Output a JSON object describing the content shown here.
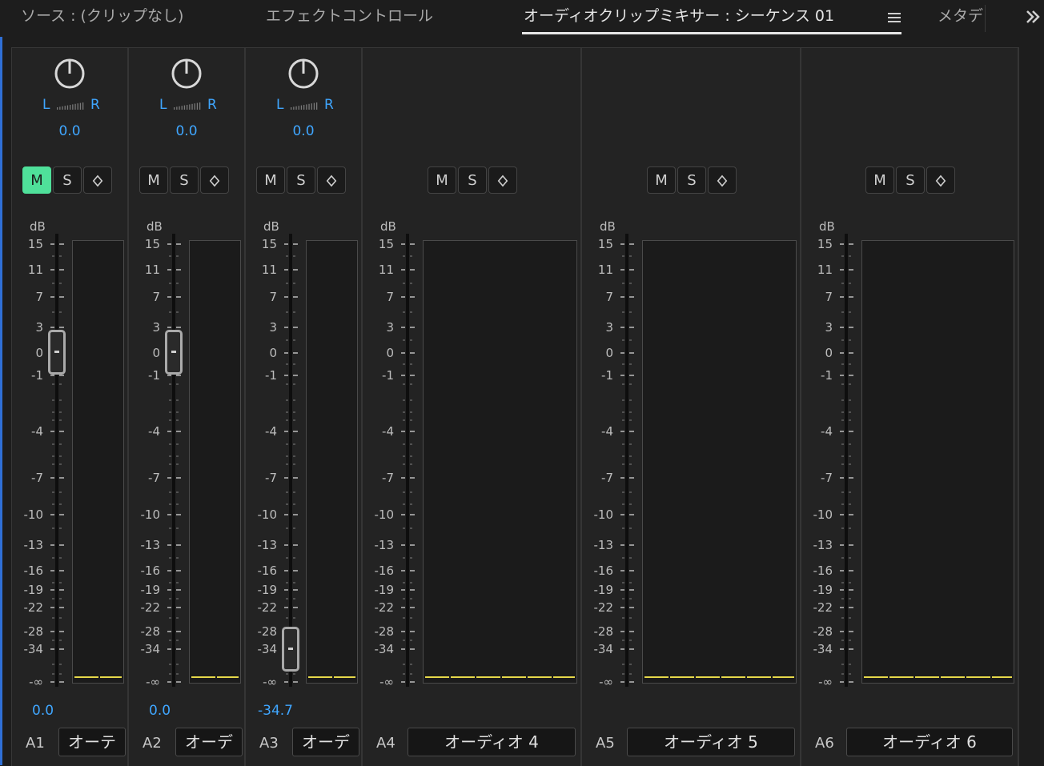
{
  "tabs": [
    {
      "label": "ソース : (クリップなし)",
      "active": false
    },
    {
      "label": "エフェクトコントロール",
      "active": false
    },
    {
      "label": "オーディオクリップミキサー : シーケンス 01",
      "active": true
    },
    {
      "label": "メタデ",
      "active": false
    }
  ],
  "tab_menu_icon": "hamburger-menu-icon",
  "overflow_icon": "double-chevron-right-icon",
  "colors": {
    "accent_blue": "#3fa6ff",
    "mute_on": "#4fe09a",
    "meter_line": "#e6d84a",
    "background": "#232323"
  },
  "buttons": {
    "mute": "M",
    "solo": "S",
    "keyframe_icon": "diamond-keyframe-icon"
  },
  "db_label": "dB",
  "db_ticks": [
    "15",
    "11",
    "7",
    "3",
    "0",
    "-1",
    "-4",
    "-7",
    "-10",
    "-13",
    "-16",
    "-19",
    "-22",
    "-28",
    "-34",
    "-∞"
  ],
  "pan": {
    "left": "L",
    "right": "R"
  },
  "channels": [
    {
      "id": "A1",
      "name": "オーテ",
      "pan_value": "0.0",
      "fader_value": "0.0",
      "fader_db": 0,
      "muted": true,
      "has_pan": true,
      "has_fader": true
    },
    {
      "id": "A2",
      "name": "オーデ",
      "pan_value": "0.0",
      "fader_value": "0.0",
      "fader_db": 0,
      "muted": false,
      "has_pan": true,
      "has_fader": true
    },
    {
      "id": "A3",
      "name": "オーデ",
      "pan_value": "0.0",
      "fader_value": "-34.7",
      "fader_db": -34.7,
      "muted": false,
      "has_pan": true,
      "has_fader": true
    },
    {
      "id": "A4",
      "name": "オーディオ 4",
      "muted": false,
      "has_pan": false,
      "has_fader": false
    },
    {
      "id": "A5",
      "name": "オーディオ 5",
      "muted": false,
      "has_pan": false,
      "has_fader": false
    },
    {
      "id": "A6",
      "name": "オーディオ 6",
      "muted": false,
      "has_pan": false,
      "has_fader": false
    }
  ]
}
